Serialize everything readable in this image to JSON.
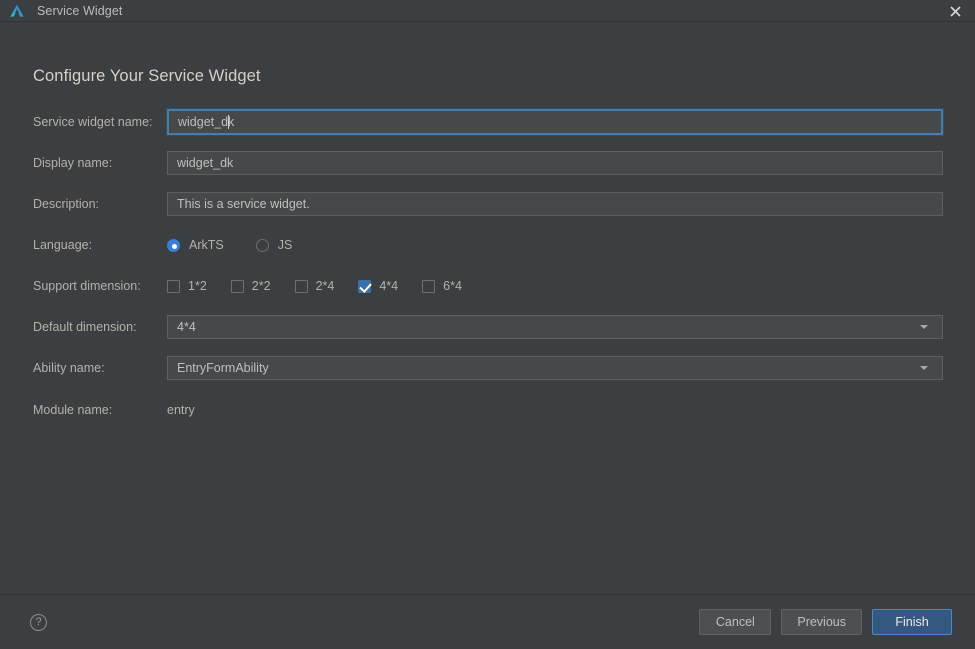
{
  "window": {
    "title": "Service Widget",
    "logo_icon": "deveco-triangle-logo",
    "close_icon": "close-icon"
  },
  "page": {
    "heading": "Configure Your Service Widget"
  },
  "form": {
    "service_widget_name": {
      "label": "Service widget name:",
      "value": "widget_dk",
      "value_before_caret": "widget_d",
      "value_after_caret": "k",
      "focused": true
    },
    "display_name": {
      "label": "Display name:",
      "value": "widget_dk"
    },
    "description": {
      "label": "Description:",
      "value": "This is a service widget."
    },
    "language": {
      "label": "Language:",
      "options": [
        {
          "label": "ArkTS",
          "selected": true
        },
        {
          "label": "JS",
          "selected": false
        }
      ]
    },
    "support_dimension": {
      "label": "Support dimension:",
      "options": [
        {
          "label": "1*2",
          "checked": false
        },
        {
          "label": "2*2",
          "checked": false
        },
        {
          "label": "2*4",
          "checked": false
        },
        {
          "label": "4*4",
          "checked": true
        },
        {
          "label": "6*4",
          "checked": false
        }
      ]
    },
    "default_dimension": {
      "label": "Default dimension:",
      "value": "4*4",
      "arrow_icon": "chevron-down-icon"
    },
    "ability_name": {
      "label": "Ability name:",
      "value": "EntryFormAbility",
      "arrow_icon": "chevron-down-icon"
    },
    "module_name": {
      "label": "Module name:",
      "value": "entry"
    }
  },
  "footer": {
    "help_icon": "help-question-icon",
    "help_label": "?",
    "cancel_label": "Cancel",
    "previous_label": "Previous",
    "finish_label": "Finish"
  },
  "colors": {
    "dialog_bg": "#3c3f41",
    "field_bg": "#45494a",
    "accent_blue": "#3b7ddd",
    "checkbox_blue": "#3b6fa8",
    "primary_button_bg": "#365880",
    "primary_button_border": "#4a88c7",
    "text": "#b4b0ab"
  }
}
